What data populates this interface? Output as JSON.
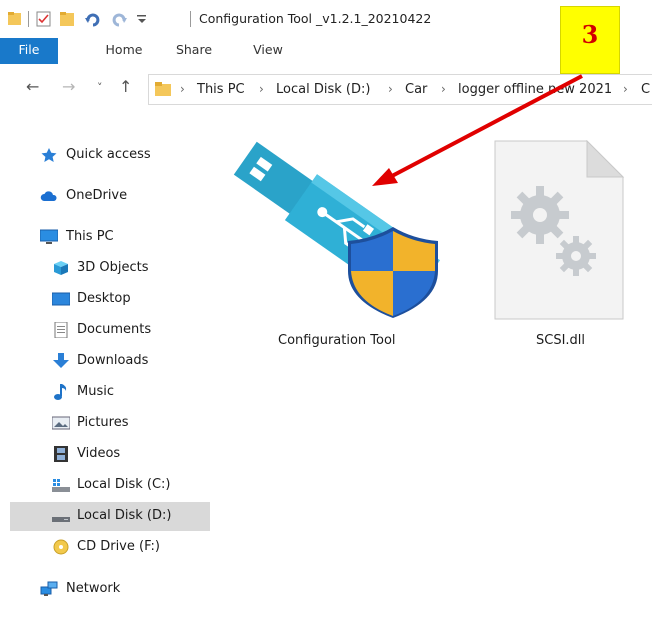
{
  "window": {
    "title": "Configuration Tool _v1.2.1_20210422"
  },
  "ribbon": {
    "tabs": [
      {
        "label": "File"
      },
      {
        "label": "Home"
      },
      {
        "label": "Share"
      },
      {
        "label": "View"
      }
    ]
  },
  "address": {
    "crumbs": [
      "This PC",
      "Local Disk (D:)",
      "Car",
      "logger offline new 2021",
      "C"
    ]
  },
  "sidebar": {
    "items": [
      {
        "label": "Quick access",
        "icon": "star-icon"
      },
      {
        "label": "OneDrive",
        "icon": "cloud-icon"
      },
      {
        "label": "This PC",
        "icon": "monitor-icon"
      },
      {
        "label": "3D Objects",
        "icon": "cube-icon"
      },
      {
        "label": "Desktop",
        "icon": "desktop-icon"
      },
      {
        "label": "Documents",
        "icon": "document-icon"
      },
      {
        "label": "Downloads",
        "icon": "download-arrow-icon"
      },
      {
        "label": "Music",
        "icon": "music-note-icon"
      },
      {
        "label": "Pictures",
        "icon": "picture-icon"
      },
      {
        "label": "Videos",
        "icon": "film-icon"
      },
      {
        "label": "Local Disk (C:)",
        "icon": "drive-windows-icon"
      },
      {
        "label": "Local Disk (D:)",
        "icon": "drive-icon",
        "selected": true
      },
      {
        "label": "CD Drive (F:)",
        "icon": "cd-icon"
      },
      {
        "label": "Network",
        "icon": "network-icon"
      }
    ]
  },
  "files": [
    {
      "label": "Configuration Tool",
      "icon": "usb-shield-icon"
    },
    {
      "label": "SCSI.dll",
      "icon": "dll-gears-icon"
    }
  ],
  "annotation": {
    "number": "3",
    "color": "#d10000",
    "background": "#ffff00"
  }
}
